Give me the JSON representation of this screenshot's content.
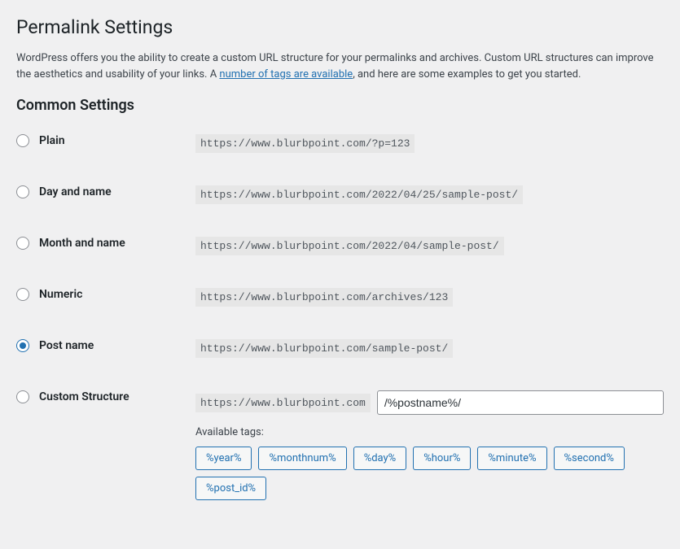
{
  "page": {
    "title": "Permalink Settings",
    "intro_part1": "WordPress offers you the ability to create a custom URL structure for your permalinks and archives. Custom URL structures can improve the aesthetics and usability of your links. A ",
    "intro_link": "number of tags are available",
    "intro_part2": ", and here are some examples to get you started.",
    "common_heading": "Common Settings"
  },
  "options": {
    "plain": {
      "label": "Plain",
      "example": "https://www.blurbpoint.com/?p=123"
    },
    "day_name": {
      "label": "Day and name",
      "example": "https://www.blurbpoint.com/2022/04/25/sample-post/"
    },
    "month_name": {
      "label": "Month and name",
      "example": "https://www.blurbpoint.com/2022/04/sample-post/"
    },
    "numeric": {
      "label": "Numeric",
      "example": "https://www.blurbpoint.com/archives/123"
    },
    "post_name": {
      "label": "Post name",
      "example": "https://www.blurbpoint.com/sample-post/"
    },
    "custom": {
      "label": "Custom Structure",
      "base": "https://www.blurbpoint.com",
      "value": "/%postname%/",
      "available_label": "Available tags:"
    }
  },
  "tags": {
    "t0": "%year%",
    "t1": "%monthnum%",
    "t2": "%day%",
    "t3": "%hour%",
    "t4": "%minute%",
    "t5": "%second%",
    "t6": "%post_id%"
  },
  "selected": "post_name"
}
